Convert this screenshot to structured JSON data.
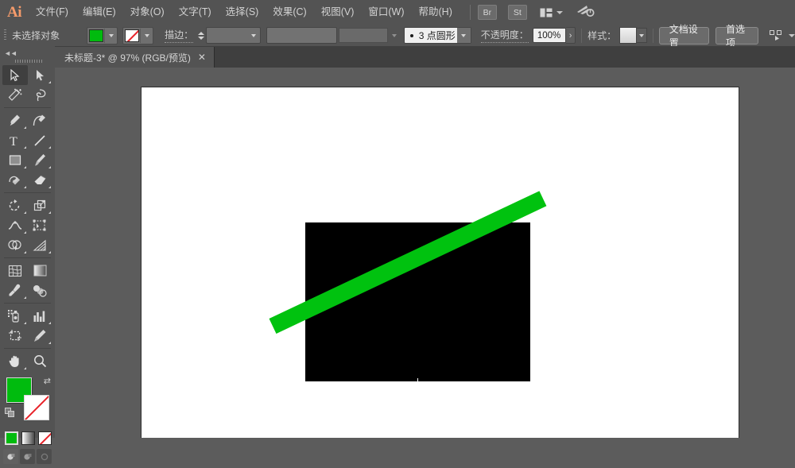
{
  "app": {
    "name": "Adobe Illustrator",
    "logo_text": "Ai"
  },
  "menubar": {
    "items": [
      {
        "label": "文件(F)",
        "name": "menu-file"
      },
      {
        "label": "编辑(E)",
        "name": "menu-edit"
      },
      {
        "label": "对象(O)",
        "name": "menu-object"
      },
      {
        "label": "文字(T)",
        "name": "menu-type"
      },
      {
        "label": "选择(S)",
        "name": "menu-select"
      },
      {
        "label": "效果(C)",
        "name": "menu-effect"
      },
      {
        "label": "视图(V)",
        "name": "menu-view"
      },
      {
        "label": "窗口(W)",
        "name": "menu-window"
      },
      {
        "label": "帮助(H)",
        "name": "menu-help"
      }
    ],
    "bridge_label": "Br",
    "stock_label": "St",
    "arrange_label": "arrange-documents-icon",
    "cc_label": "creative-cloud-icon"
  },
  "options_bar": {
    "selection_status": "未选择对象",
    "fill_color": "#00bb0e",
    "stroke_color": "none",
    "stroke_label": "描边：",
    "stroke_weight_value": "",
    "variable_width_profile": "",
    "brush_definition": "3 点圆形",
    "opacity_label": "不透明度：",
    "opacity_value": "100%",
    "style_label": "样式：",
    "document_setup_button": "文档设置",
    "preferences_button": "首选项",
    "align_icon": "align-to-selection-icon"
  },
  "tab": {
    "title": "未标题-3* @ 97% (RGB/预览)",
    "close": "✕"
  },
  "tools": [
    {
      "name": "selection-tool",
      "label": "选择工具",
      "active": true,
      "corner": false
    },
    {
      "name": "direct-selection-tool",
      "label": "直接选择工具",
      "active": false,
      "corner": true
    },
    {
      "name": "magic-wand-tool",
      "label": "魔棒工具",
      "active": false,
      "corner": false
    },
    {
      "name": "lasso-tool",
      "label": "套索工具",
      "active": false,
      "corner": false
    },
    {
      "name": "pen-tool",
      "label": "钢笔工具",
      "active": false,
      "corner": true
    },
    {
      "name": "curvature-tool",
      "label": "曲率工具",
      "active": false,
      "corner": false
    },
    {
      "name": "type-tool",
      "label": "文字工具",
      "active": false,
      "corner": true
    },
    {
      "name": "line-segment-tool",
      "label": "直线段工具",
      "active": false,
      "corner": true
    },
    {
      "name": "rectangle-tool",
      "label": "矩形工具",
      "active": false,
      "corner": true
    },
    {
      "name": "paintbrush-tool",
      "label": "画笔工具",
      "active": false,
      "corner": true
    },
    {
      "name": "shaper-tool",
      "label": "Shaper 工具",
      "active": false,
      "corner": true
    },
    {
      "name": "eraser-tool",
      "label": "橡皮擦工具",
      "active": false,
      "corner": true
    },
    {
      "name": "rotate-tool",
      "label": "旋转工具",
      "active": false,
      "corner": true
    },
    {
      "name": "scale-tool",
      "label": "比例缩放工具",
      "active": false,
      "corner": true
    },
    {
      "name": "width-tool",
      "label": "宽度工具",
      "active": false,
      "corner": true
    },
    {
      "name": "free-transform-tool",
      "label": "自由变换工具",
      "active": false,
      "corner": false
    },
    {
      "name": "shape-builder-tool",
      "label": "形状生成器工具",
      "active": false,
      "corner": true
    },
    {
      "name": "perspective-grid-tool",
      "label": "透视网格工具",
      "active": false,
      "corner": true
    },
    {
      "name": "mesh-tool",
      "label": "网格工具",
      "active": false,
      "corner": false
    },
    {
      "name": "gradient-tool",
      "label": "渐变工具",
      "active": false,
      "corner": false
    },
    {
      "name": "eyedropper-tool",
      "label": "吸管工具",
      "active": false,
      "corner": true
    },
    {
      "name": "blend-tool",
      "label": "混合工具",
      "active": false,
      "corner": false
    },
    {
      "name": "symbol-sprayer-tool",
      "label": "符号喷枪工具",
      "active": false,
      "corner": true
    },
    {
      "name": "column-graph-tool",
      "label": "柱形图工具",
      "active": false,
      "corner": true
    },
    {
      "name": "artboard-tool",
      "label": "画板工具",
      "active": false,
      "corner": false
    },
    {
      "name": "slice-tool",
      "label": "切片工具",
      "active": false,
      "corner": true
    },
    {
      "name": "hand-tool",
      "label": "抓手工具",
      "active": false,
      "corner": true
    },
    {
      "name": "zoom-tool",
      "label": "缩放工具",
      "active": false,
      "corner": false
    }
  ],
  "color_controls": {
    "fill_color": "#00bb0e",
    "stroke_color": "none",
    "swap_icon": "swap-fill-stroke-icon",
    "default_icon": "default-fill-stroke-icon",
    "modes": [
      {
        "name": "color-mode-button",
        "label": "颜色",
        "active": true
      },
      {
        "name": "gradient-mode-button",
        "label": "渐变",
        "active": false
      },
      {
        "name": "none-mode-button",
        "label": "无",
        "active": false
      }
    ],
    "screen_modes": [
      {
        "name": "drawing-mode-normal",
        "active": true
      },
      {
        "name": "drawing-mode-behind",
        "active": false
      },
      {
        "name": "drawing-mode-inside",
        "active": false
      }
    ]
  },
  "canvas": {
    "zoom": "97%",
    "artwork": [
      {
        "name": "black-rectangle",
        "shape": "rect",
        "fill": "#000000"
      },
      {
        "name": "green-diagonal-line",
        "shape": "line",
        "fill": "#00c20f",
        "rotation_deg": -25.3
      }
    ]
  }
}
